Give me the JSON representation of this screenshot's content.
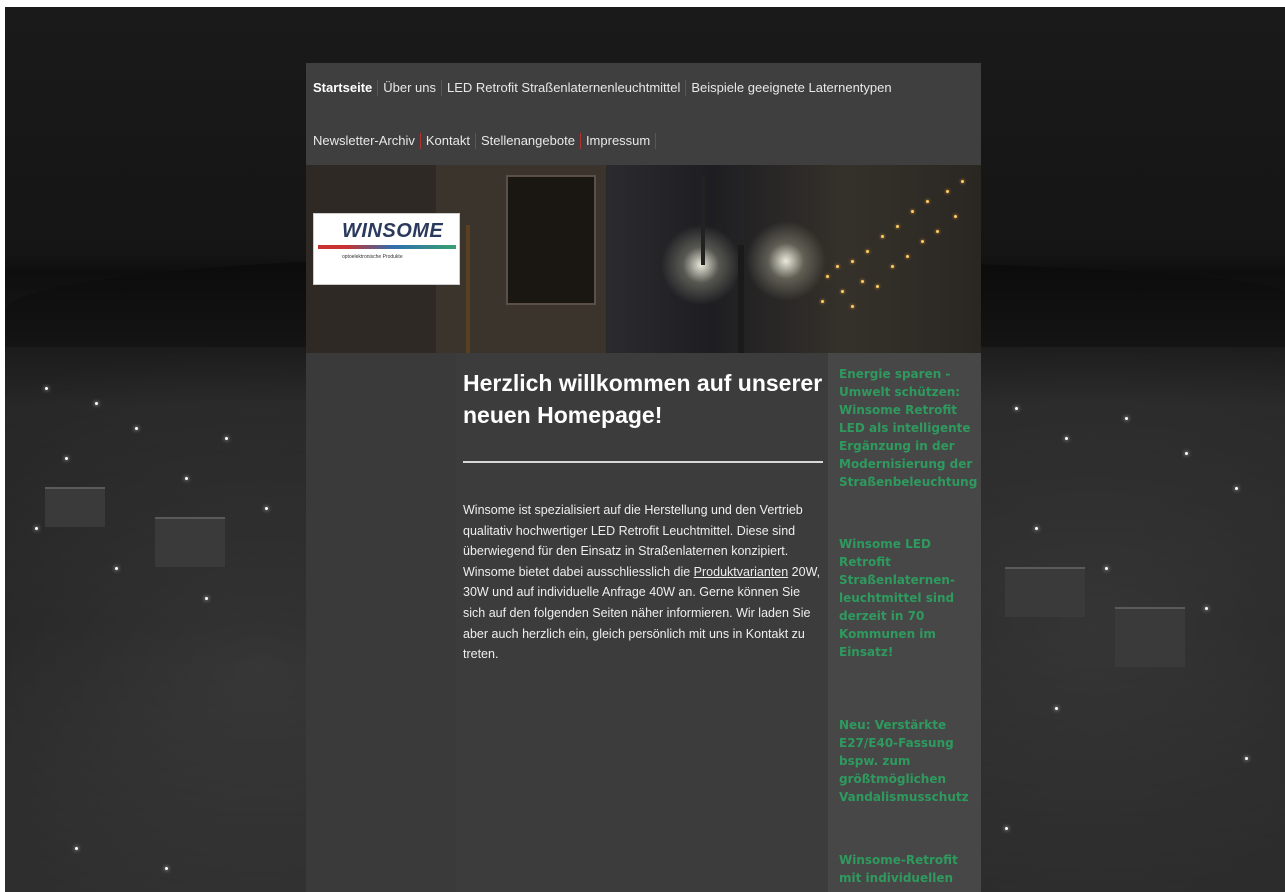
{
  "nav": {
    "row1": [
      "Startseite",
      "Über uns",
      "LED Retrofit Straßenlaternenleuchtmittel",
      "Beispiele geeignete Laternentypen"
    ],
    "row2": [
      "Newsletter-Archiv",
      "Kontakt",
      "Stellenangebote",
      "Impressum"
    ],
    "active": "Startseite"
  },
  "logo": {
    "name": "WINSOME",
    "tagline": "optoelektronische Produkte"
  },
  "main": {
    "heading": "Herzlich willkommen auf unserer neuen Homepage!",
    "intro_before_link": "Winsome ist spezialisiert auf die Herstellung und den Vertrieb qualitativ hochwertiger LED Retrofit Leuchtmittel. Diese sind überwiegend für den Einsatz in Straßenlaternen konzipiert. Winsome bietet dabei ausschliesslich die ",
    "intro_link": "Produktvarianten",
    "intro_after_link": " 20W, 30W und auf individuelle Anfrage 40W an. Gerne können Sie sich auf den folgenden Seiten näher informieren. Wir laden Sie aber auch herzlich ein, gleich persönlich mit uns in Kontakt zu treten."
  },
  "sidebar": {
    "items": [
      "Energie sparen - Umwelt schützen: Winsome Retrofit LED als intelligente Ergänzung in der Modernisierung der Straßenbeleuchtung",
      "Winsome LED Retrofit Straßenlaternen-leuchtmittel sind derzeit in 70 Kommunen im Einsatz!",
      "Neu: Verstärkte E27/E40-Fassung bspw. zum größtmöglichen Vandalismusschutz",
      "Winsome-Retrofit mit individuellen"
    ]
  },
  "colors": {
    "sidebar_text": "#2e9a5e",
    "nav_divider": "#b03030",
    "page_bg": "#3a3a3a"
  }
}
